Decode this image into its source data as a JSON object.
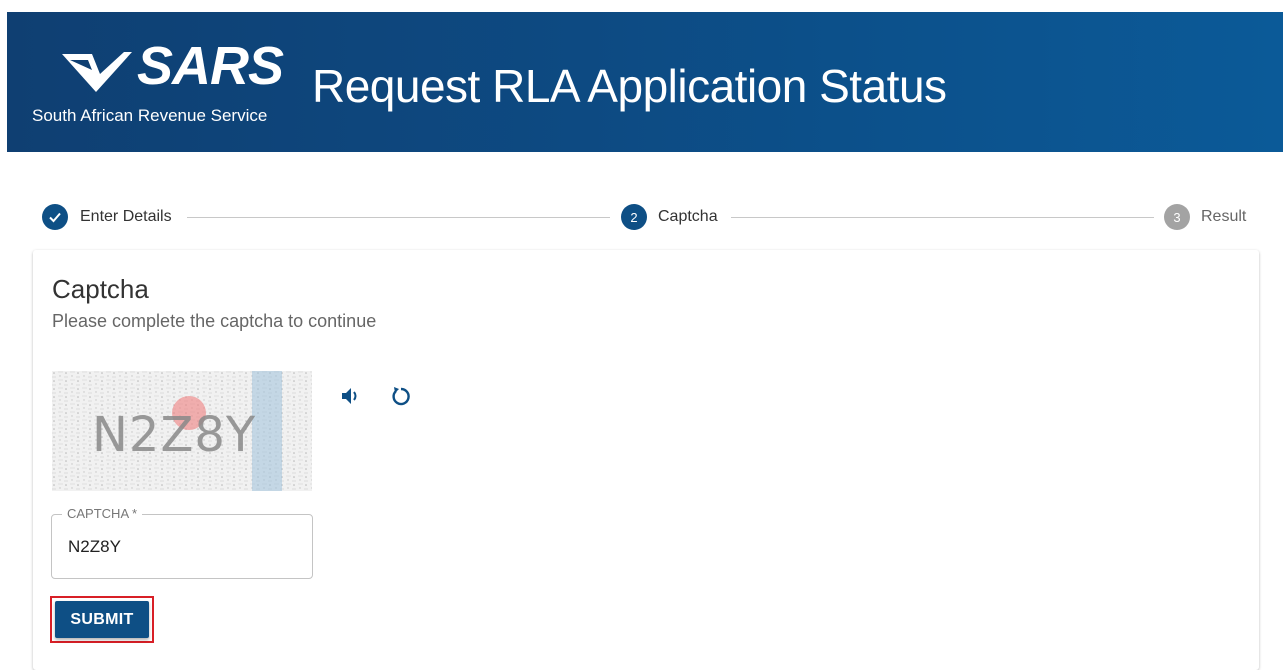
{
  "header": {
    "logo_text": "SARS",
    "logo_subtitle": "South African Revenue Service",
    "title": "Request RLA Application Status"
  },
  "stepper": {
    "steps": [
      {
        "number": "1",
        "label": "Enter Details",
        "state": "completed"
      },
      {
        "number": "2",
        "label": "Captcha",
        "state": "active"
      },
      {
        "number": "3",
        "label": "Result",
        "state": "pending"
      }
    ]
  },
  "card": {
    "title": "Captcha",
    "subtitle": "Please complete the captcha to continue",
    "captcha_image_text": "N2Z8Y",
    "audio_icon": "volume-icon",
    "refresh_icon": "refresh-icon",
    "field_label": "CAPTCHA *",
    "field_value": "N2Z8Y",
    "submit_label": "SUBMIT"
  },
  "colors": {
    "brand_blue": "#0e4f85",
    "header_dark": "#0f3f72",
    "highlight_red": "#d81f26",
    "pending_gray": "#9e9e9e"
  }
}
